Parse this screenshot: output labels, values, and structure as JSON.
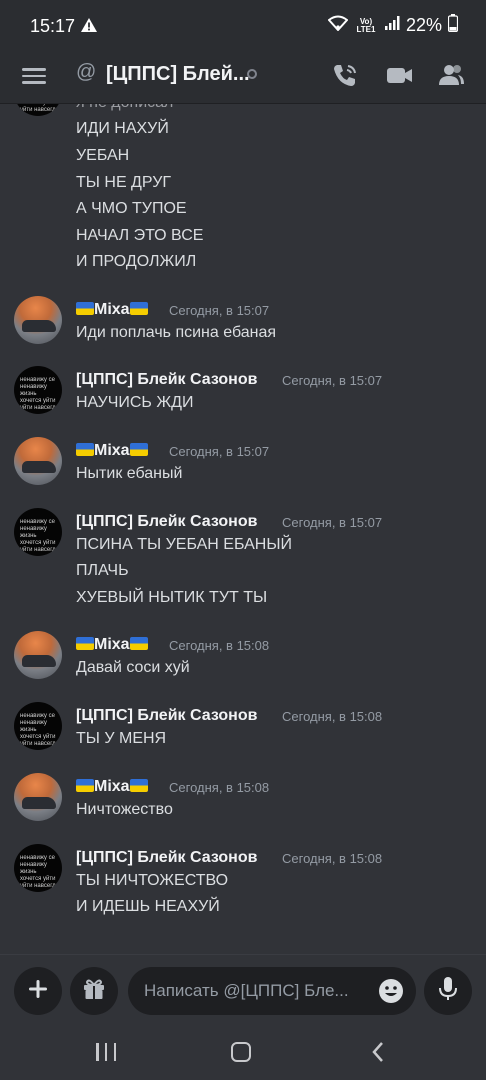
{
  "status_bar": {
    "time": "15:17",
    "lte_label": "Vo) LTE1",
    "battery": "22%"
  },
  "header": {
    "title": "[ЦППС] Блей...",
    "at_symbol": "@"
  },
  "messages": {
    "partial_top": "я не дописал",
    "continuation_lines": [
      "ИДИ НАХУЙ",
      "УЕБАН",
      "ТЫ НЕ ДРУГ",
      "А ЧМО ТУПОЕ",
      "НАЧАЛ  ЭТО ВСЕ",
      "И ПРОДОЛЖИЛ"
    ],
    "groups": [
      {
        "author": "Mixa",
        "time": "Сегодня, в 15:07",
        "lines": [
          "Иди поплачь псина ебаная"
        ]
      },
      {
        "author": "[ЦППС] Блейк Сазонов",
        "time": "Сегодня, в 15:07",
        "lines": [
          "НАУЧИСЬ ЖДИ"
        ]
      },
      {
        "author": "Mixa",
        "time": "Сегодня, в 15:07",
        "lines": [
          "Нытик ебаный"
        ]
      },
      {
        "author": "[ЦППС] Блейк Сазонов",
        "time": "Сегодня, в 15:07",
        "lines": [
          "ПСИНА ТЫ УЕБАН ЕБАНЫЙ",
          "ПЛАЧЬ",
          "ХУЕВЫЙ НЫТИК ТУТ ТЫ"
        ]
      },
      {
        "author": "Mixa",
        "time": "Сегодня, в 15:08",
        "lines": [
          "Давай соси хуй"
        ]
      },
      {
        "author": "[ЦППС] Блейк Сазонов",
        "time": "Сегодня, в 15:08",
        "lines": [
          "ТЫ У МЕНЯ"
        ]
      },
      {
        "author": "Mixa",
        "time": "Сегодня, в 15:08",
        "lines": [
          "Ничтожество"
        ]
      },
      {
        "author": "[ЦППС] Блейк Сазонов",
        "time": "Сегодня, в 15:08",
        "lines": [
          "ТЫ НИЧТОЖЕСТВО",
          "И ИДЕШЬ НЕАХУЙ"
        ]
      }
    ],
    "avatar_text": [
      "ненавижу се",
      "ненавижу жизнь",
      "хочется уйти",
      "уйти навсегд"
    ]
  },
  "composer": {
    "placeholder": "Написать @[ЦППС] Бле..."
  },
  "colors": {
    "background": "#313338",
    "header": "#2b2d31",
    "input": "#1e1f22",
    "flag_blue": "#2f6fd6",
    "flag_yellow": "#f5cd00"
  }
}
